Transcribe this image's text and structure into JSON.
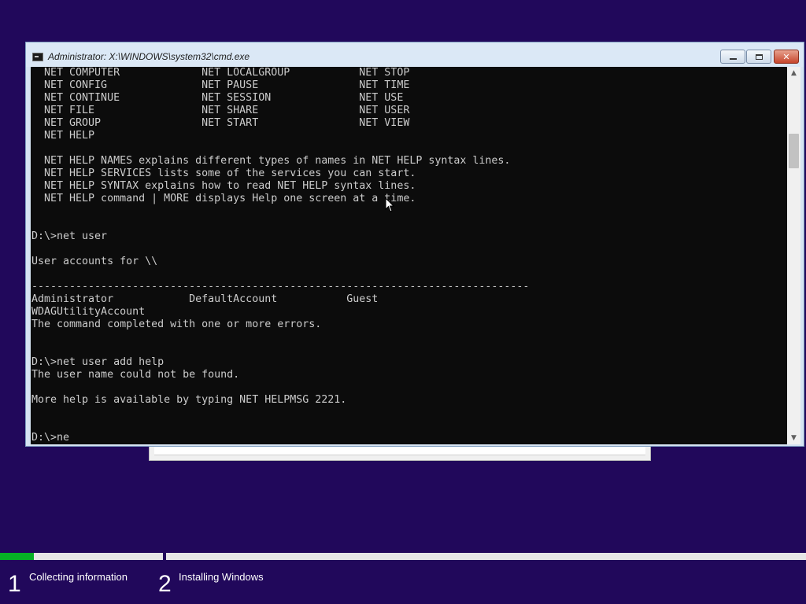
{
  "window": {
    "title": "Administrator: X:\\WINDOWS\\system32\\cmd.exe",
    "minimize_icon": "minimize-icon",
    "maximize_icon": "maximize-icon",
    "close_icon": "close-icon"
  },
  "console": {
    "lines": [
      "  NET COMPUTER             NET LOCALGROUP           NET STOP",
      "  NET CONFIG               NET PAUSE                NET TIME",
      "  NET CONTINUE             NET SESSION              NET USE",
      "  NET FILE                 NET SHARE                NET USER",
      "  NET GROUP                NET START                NET VIEW",
      "  NET HELP",
      "",
      "  NET HELP NAMES explains different types of names in NET HELP syntax lines.",
      "  NET HELP SERVICES lists some of the services you can start.",
      "  NET HELP SYNTAX explains how to read NET HELP syntax lines.",
      "  NET HELP command | MORE displays Help one screen at a time.",
      "",
      "",
      "D:\\>net user",
      "",
      "User accounts for \\\\",
      "",
      "-------------------------------------------------------------------------------",
      "Administrator            DefaultAccount           Guest",
      "WDAGUtilityAccount",
      "The command completed with one or more errors.",
      "",
      "",
      "D:\\>net user add help",
      "The user name could not be found.",
      "",
      "More help is available by typing NET HELPMSG 2221.",
      "",
      "",
      "D:\\>ne"
    ]
  },
  "setup": {
    "progress": {
      "step1_fraction": 0.21
    },
    "steps": [
      {
        "number": "1",
        "label": "Collecting information"
      },
      {
        "number": "2",
        "label": "Installing Windows"
      }
    ]
  }
}
